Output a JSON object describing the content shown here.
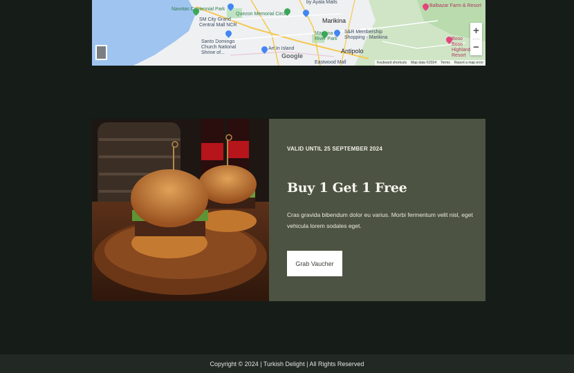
{
  "map": {
    "places": [
      {
        "name": "Navotas Centennial Park",
        "kind": "green"
      },
      {
        "name": "Quezon Memorial Circle",
        "kind": "green"
      },
      {
        "name": "by Ayala Malls",
        "kind": "normal"
      },
      {
        "name": "Balbazar Farm & Resort",
        "kind": "pink"
      },
      {
        "name": "SM City Grand Central Mall NCR",
        "kind": "normal"
      },
      {
        "name": "Marikina",
        "kind": "big"
      },
      {
        "name": "Marikina River Park",
        "kind": "green"
      },
      {
        "name": "S&R Membership Shopping - Marikina",
        "kind": "normal"
      },
      {
        "name": "Santo Domingo Church National Shrine of...",
        "kind": "normal"
      },
      {
        "name": "Art In Island",
        "kind": "normal"
      },
      {
        "name": "Boso Boso Highland Resort",
        "kind": "pink"
      },
      {
        "name": "Antipolo",
        "kind": "big"
      },
      {
        "name": "Eastwood Mall",
        "kind": "normal"
      }
    ],
    "google_logo": "Google",
    "zoom_in": "+",
    "zoom_out": "−",
    "footer_links": [
      "Keyboard shortcuts",
      "Map data ©2024",
      "Terms",
      "Report a map error"
    ]
  },
  "promo": {
    "valid_until": "VALID UNTIL 25 SEPTEMBER 2024",
    "title": "Buy 1 Get 1 Free",
    "description": "Cras gravida bibendum dolor eu varius. Morbi fermentum velit nisl, eget vehicula lorem sodales eget.",
    "button_label": "Grab Vaucher",
    "image_alt": "Two burgers on a wooden board"
  },
  "footer": {
    "copyright": "Copyright © 2024 | Turkish Delight | All Rights Reserved"
  },
  "colors": {
    "page_bg": "#161c18",
    "panel_bg": "#4c5342",
    "footer_bg": "#222924"
  }
}
